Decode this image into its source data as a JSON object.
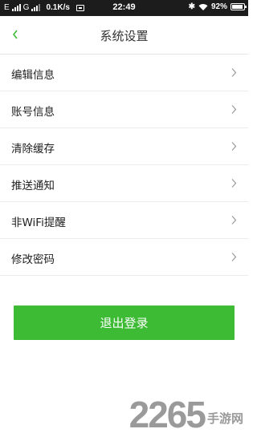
{
  "status_bar": {
    "sim1_label": "E",
    "sim2_label": "G",
    "net_speed": "0.1K/s",
    "time": "22:49",
    "battery_level": 0.92,
    "battery": "92%"
  },
  "header": {
    "title": "系统设置",
    "back_icon": "chevron-left-icon",
    "accent_color": "#3dbb35"
  },
  "settings": {
    "items": [
      {
        "label": "编辑信息"
      },
      {
        "label": "账号信息"
      },
      {
        "label": "清除缓存"
      },
      {
        "label": "推送通知"
      },
      {
        "label": "非WiFi提醒"
      },
      {
        "label": "修改密码"
      }
    ]
  },
  "logout": {
    "label": "退出登录",
    "color": "#3dbb35"
  },
  "watermark": {
    "number": "2265",
    "text": "手游网"
  }
}
